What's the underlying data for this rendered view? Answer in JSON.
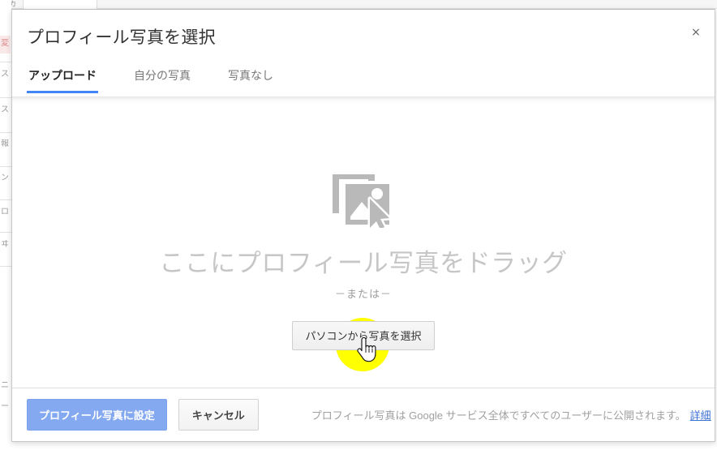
{
  "dialog": {
    "title": "プロフィール写真を選択",
    "close_label": "×",
    "close_icon": "close-icon"
  },
  "tabs": [
    {
      "label": "アップロード",
      "active": true
    },
    {
      "label": "自分の写真",
      "active": false
    },
    {
      "label": "写真なし",
      "active": false
    }
  ],
  "dropzone": {
    "icon": "photos-stack-with-cursor-icon",
    "drag_text": "ここにプロフィール写真をドラッグ",
    "or_text": "－または－",
    "choose_button_label": "パソコンから写真を選択",
    "cursor_icon": "hand-pointer-cursor",
    "highlight_color": "#ffff00"
  },
  "footer": {
    "primary_button_label": "プロフィール写真に設定",
    "primary_button_disabled": true,
    "cancel_button_label": "キャンセル",
    "note_text": "プロフィール写真は Google サービス全体ですべてのユーザーに公開されます。",
    "note_link_label": "詳細"
  },
  "background": {
    "topbar_fragment": "アカ",
    "left_fragments": [
      "変",
      "ス",
      "ス",
      "報",
      "ン",
      "ロ",
      "ヰ",
      "ニ",
      "ー"
    ]
  },
  "colors": {
    "accent_blue": "#4285f4",
    "primary_disabled_blue": "#84a9f0",
    "link_blue": "#3b6fd4",
    "title_text": "#333333",
    "muted_text": "#a0a0a0",
    "dropzone_text": "#c6c6c6",
    "highlight_yellow": "#ffff00"
  }
}
